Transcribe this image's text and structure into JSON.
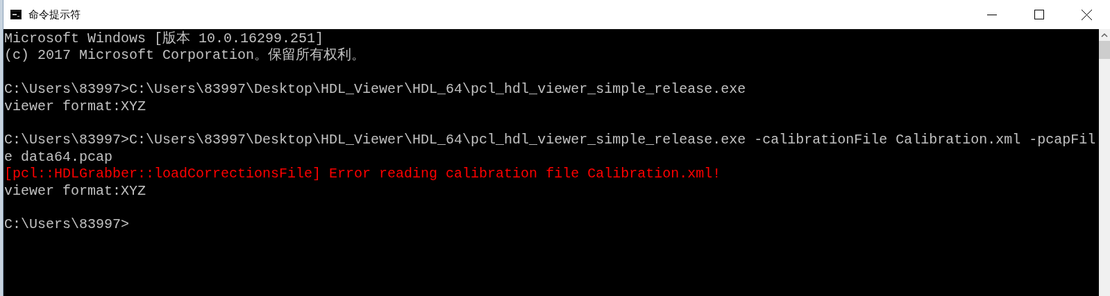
{
  "window": {
    "title": "命令提示符"
  },
  "console": {
    "lines": [
      {
        "kind": "output",
        "text": "Microsoft Windows [版本 10.0.16299.251]"
      },
      {
        "kind": "output",
        "text": "(c) 2017 Microsoft Corporation。保留所有权利。"
      },
      {
        "kind": "blank"
      },
      {
        "kind": "output",
        "text": "C:\\Users\\83997>C:\\Users\\83997\\Desktop\\HDL_Viewer\\HDL_64\\pcl_hdl_viewer_simple_release.exe"
      },
      {
        "kind": "output",
        "text": "viewer format:XYZ"
      },
      {
        "kind": "blank"
      },
      {
        "kind": "output",
        "text": "C:\\Users\\83997>C:\\Users\\83997\\Desktop\\HDL_Viewer\\HDL_64\\pcl_hdl_viewer_simple_release.exe -calibrationFile Calibration.xml -pcapFil"
      },
      {
        "kind": "output",
        "text": "e data64.pcap"
      },
      {
        "kind": "error",
        "text": "[pcl::HDLGrabber::loadCorrectionsFile] Error reading calibration file Calibration.xml!"
      },
      {
        "kind": "output",
        "text": "viewer format:XYZ"
      },
      {
        "kind": "blank"
      },
      {
        "kind": "output",
        "text": "C:\\Users\\83997>"
      }
    ]
  }
}
